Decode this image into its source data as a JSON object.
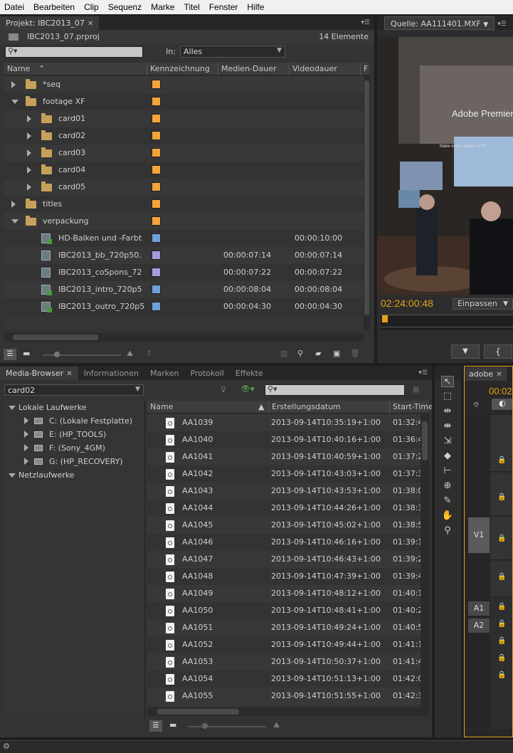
{
  "menu": [
    "Datei",
    "Bearbeiten",
    "Clip",
    "Sequenz",
    "Marke",
    "Titel",
    "Fenster",
    "Hilfe"
  ],
  "project": {
    "tab": "Projekt: IBC2013_07",
    "filename": "IBC2013_07.prproj",
    "count": "14 Elemente",
    "search_placeholder": "",
    "in_label": "In:",
    "in_value": "Alles",
    "columns": [
      "Name",
      "Kennzeichnung",
      "Medien-Dauer",
      "Videodauer",
      "F"
    ],
    "rows": [
      {
        "name": "*seq",
        "type": "folder",
        "level": 0,
        "open": false,
        "color": "orange",
        "media": "",
        "video": ""
      },
      {
        "name": "footage XF",
        "type": "folder",
        "level": 0,
        "open": true,
        "color": "orange",
        "media": "",
        "video": ""
      },
      {
        "name": "card01",
        "type": "folder",
        "level": 1,
        "open": false,
        "color": "orange",
        "media": "",
        "video": ""
      },
      {
        "name": "card02",
        "type": "folder",
        "level": 1,
        "open": false,
        "color": "orange",
        "media": "",
        "video": ""
      },
      {
        "name": "card03",
        "type": "folder",
        "level": 1,
        "open": false,
        "color": "orange",
        "media": "",
        "video": ""
      },
      {
        "name": "card04",
        "type": "folder",
        "level": 1,
        "open": false,
        "color": "orange",
        "media": "",
        "video": ""
      },
      {
        "name": "card05",
        "type": "folder",
        "level": 1,
        "open": false,
        "color": "orange",
        "media": "",
        "video": ""
      },
      {
        "name": "titles",
        "type": "folder",
        "level": 0,
        "open": false,
        "color": "orange",
        "media": "",
        "video": ""
      },
      {
        "name": "verpackung",
        "type": "folder",
        "level": 0,
        "open": true,
        "color": "orange",
        "media": "",
        "video": ""
      },
      {
        "name": "HD-Balken und -Farbt",
        "type": "clipfx",
        "level": 1,
        "color": "blue",
        "media": "",
        "video": "00:00:10:00"
      },
      {
        "name": "IBC2013_bb_720p50.",
        "type": "clip",
        "level": 1,
        "color": "violet",
        "media": "00:00:07:14",
        "video": "00:00:07:14"
      },
      {
        "name": "IBC2013_coSpons_72",
        "type": "clip",
        "level": 1,
        "color": "violet",
        "media": "00:00:07:22",
        "video": "00:00:07:22"
      },
      {
        "name": "IBC2013_intro_720p5",
        "type": "clipfx",
        "level": 1,
        "color": "blue",
        "media": "00:00:08:04",
        "video": "00:00:08:04"
      },
      {
        "name": "IBC2013_outro_720p5",
        "type": "clipfx",
        "level": 1,
        "color": "blue",
        "media": "00:00:04:30",
        "video": "00:00:04:30"
      }
    ]
  },
  "source": {
    "tab": "Quelle: AA111401.MXF",
    "timecode": "02:24:00:48",
    "fit": "Einpassen",
    "screen_text": "Adobe Premiere",
    "screen_sub": "Make every screen a TV"
  },
  "media_browser": {
    "tabs": [
      "Media-Browser",
      "Informationen",
      "Marken",
      "Protokoll",
      "Effekte"
    ],
    "folder": "card02",
    "tree": [
      {
        "label": "Lokale Laufwerke",
        "level": 0,
        "open": true
      },
      {
        "label": "C: (Lokale Festplatte)",
        "level": 1
      },
      {
        "label": "E: (HP_TOOLS)",
        "level": 1
      },
      {
        "label": "F: (Sony_4GM)",
        "level": 1
      },
      {
        "label": "G: (HP_RECOVERY)",
        "level": 1
      },
      {
        "label": "Netzlaufwerke",
        "level": 0,
        "open": true
      }
    ],
    "columns": [
      "Name",
      "Erstellungsdatum",
      "Start-Time"
    ],
    "files": [
      {
        "name": "AA1039",
        "date": "2013-09-14T10:35:19+1:00",
        "start": "01:32:4"
      },
      {
        "name": "AA1040",
        "date": "2013-09-14T10:40:16+1:00",
        "start": "01:36:4"
      },
      {
        "name": "AA1041",
        "date": "2013-09-14T10:40:59+1:00",
        "start": "01:37:2"
      },
      {
        "name": "AA1042",
        "date": "2013-09-14T10:43:03+1:00",
        "start": "01:37:3"
      },
      {
        "name": "AA1043",
        "date": "2013-09-14T10:43:53+1:00",
        "start": "01:38:0"
      },
      {
        "name": "AA1044",
        "date": "2013-09-14T10:44:26+1:00",
        "start": "01:38:3"
      },
      {
        "name": "AA1045",
        "date": "2013-09-14T10:45:02+1:00",
        "start": "01:38:5"
      },
      {
        "name": "AA1046",
        "date": "2013-09-14T10:46:16+1:00",
        "start": "01:39:1"
      },
      {
        "name": "AA1047",
        "date": "2013-09-14T10:46:43+1:00",
        "start": "01:39:2"
      },
      {
        "name": "AA1048",
        "date": "2013-09-14T10:47:39+1:00",
        "start": "01:39:4"
      },
      {
        "name": "AA1049",
        "date": "2013-09-14T10:48:12+1:00",
        "start": "01:40:1"
      },
      {
        "name": "AA1050",
        "date": "2013-09-14T10:48:41+1:00",
        "start": "01:40:2"
      },
      {
        "name": "AA1051",
        "date": "2013-09-14T10:49:24+1:00",
        "start": "01:40:5"
      },
      {
        "name": "AA1052",
        "date": "2013-09-14T10:49:44+1:00",
        "start": "01:41:1"
      },
      {
        "name": "AA1053",
        "date": "2013-09-14T10:50:37+1:00",
        "start": "01:41:4"
      },
      {
        "name": "AA1054",
        "date": "2013-09-14T10:51:13+1:00",
        "start": "01:42:0"
      },
      {
        "name": "AA1055",
        "date": "2013-09-14T10:51:55+1:00",
        "start": "01:42:3"
      }
    ]
  },
  "timeline": {
    "tab": "adobe",
    "timecode": "00:02",
    "tracks": [
      "V1",
      "A1",
      "A2"
    ]
  },
  "colors": {
    "orange": "#f5a33b",
    "blue": "#6ea0d8",
    "violet": "#a99be0",
    "timecode": "#e6a21a"
  }
}
